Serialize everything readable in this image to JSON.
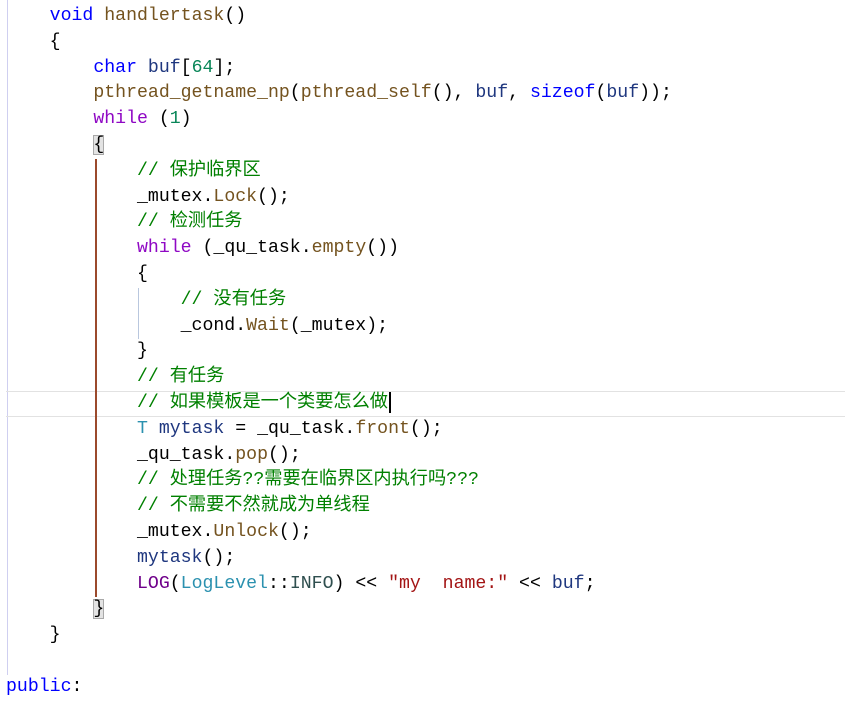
{
  "theme": {
    "background": "#ffffff",
    "text": "#000000",
    "margin_line": "#cfcff0",
    "current_line_border": "#e2e2e2",
    "brace_match_fill": "#e3e3e3",
    "brace_match_border": "#a9a9a9",
    "caret": "#000000",
    "syntax": {
      "keyword": "#0000ff",
      "control-keyword": "#8f08c4",
      "function": "#74531f",
      "local-variable": "#1f377f",
      "member-field": "#000000",
      "type": "#2b91af",
      "macro": "#6f008a",
      "enum-member": "#2f4f4f",
      "number": "#098658",
      "string": "#a31515",
      "comment": "#008000"
    }
  },
  "editor": {
    "lines": [
      {
        "tokens": [
          {
            "t": "    "
          },
          {
            "t": "void",
            "c": "#0000ff"
          },
          {
            "t": " "
          },
          {
            "t": "handlertask",
            "c": "#74531f"
          },
          {
            "t": "()"
          }
        ]
      },
      {
        "tokens": [
          {
            "t": "    "
          },
          {
            "t": "{"
          }
        ]
      },
      {
        "tokens": [
          {
            "t": "        "
          },
          {
            "t": "char",
            "c": "#0000ff"
          },
          {
            "t": " "
          },
          {
            "t": "buf",
            "c": "#1f377f"
          },
          {
            "t": "["
          },
          {
            "t": "64",
            "c": "#098658"
          },
          {
            "t": "];"
          }
        ]
      },
      {
        "tokens": [
          {
            "t": "        "
          },
          {
            "t": "pthread_getname_np",
            "c": "#74531f"
          },
          {
            "t": "("
          },
          {
            "t": "pthread_self",
            "c": "#74531f"
          },
          {
            "t": "(), "
          },
          {
            "t": "buf",
            "c": "#1f377f"
          },
          {
            "t": ", "
          },
          {
            "t": "sizeof",
            "c": "#0000ff"
          },
          {
            "t": "("
          },
          {
            "t": "buf",
            "c": "#1f377f"
          },
          {
            "t": "));"
          }
        ]
      },
      {
        "tokens": [
          {
            "t": "        "
          },
          {
            "t": "while",
            "c": "#8f08c4"
          },
          {
            "t": " ("
          },
          {
            "t": "1",
            "c": "#098658"
          },
          {
            "t": ")"
          }
        ]
      },
      {
        "tokens": [
          {
            "t": "        "
          },
          {
            "t": "{",
            "match": true
          }
        ],
        "guide": "#9b4a2c"
      },
      {
        "tokens": [
          {
            "t": "            "
          },
          {
            "t": "// 保护临界区",
            "c": "#008000"
          }
        ]
      },
      {
        "tokens": [
          {
            "t": "            "
          },
          {
            "t": "_mutex",
            "c": "#000000"
          },
          {
            "t": "."
          },
          {
            "t": "Lock",
            "c": "#74531f"
          },
          {
            "t": "();"
          }
        ]
      },
      {
        "tokens": [
          {
            "t": "            "
          },
          {
            "t": "// 检测任务",
            "c": "#008000"
          }
        ]
      },
      {
        "tokens": [
          {
            "t": "            "
          },
          {
            "t": "while",
            "c": "#8f08c4"
          },
          {
            "t": " ("
          },
          {
            "t": "_qu_task",
            "c": "#000000"
          },
          {
            "t": "."
          },
          {
            "t": "empty",
            "c": "#74531f"
          },
          {
            "t": "())"
          }
        ]
      },
      {
        "tokens": [
          {
            "t": "            "
          },
          {
            "t": "{"
          }
        ],
        "guide": "#b9c7de"
      },
      {
        "tokens": [
          {
            "t": "                "
          },
          {
            "t": "// 没有任务",
            "c": "#008000"
          }
        ]
      },
      {
        "tokens": [
          {
            "t": "                "
          },
          {
            "t": "_cond",
            "c": "#000000"
          },
          {
            "t": "."
          },
          {
            "t": "Wait",
            "c": "#74531f"
          },
          {
            "t": "("
          },
          {
            "t": "_mutex",
            "c": "#000000"
          },
          {
            "t": ");"
          }
        ]
      },
      {
        "tokens": [
          {
            "t": "            "
          },
          {
            "t": "}"
          }
        ]
      },
      {
        "tokens": [
          {
            "t": "            "
          },
          {
            "t": "// 有任务",
            "c": "#008000"
          }
        ]
      },
      {
        "tokens": [
          {
            "t": "            "
          },
          {
            "t": "// 如果模板是一个类要怎么做",
            "c": "#008000"
          }
        ],
        "current": true,
        "cursor": true
      },
      {
        "tokens": [
          {
            "t": "            "
          },
          {
            "t": "T",
            "c": "#2b91af"
          },
          {
            "t": " "
          },
          {
            "t": "mytask",
            "c": "#1f377f"
          },
          {
            "t": " = "
          },
          {
            "t": "_qu_task",
            "c": "#000000"
          },
          {
            "t": "."
          },
          {
            "t": "front",
            "c": "#74531f"
          },
          {
            "t": "();"
          }
        ]
      },
      {
        "tokens": [
          {
            "t": "            "
          },
          {
            "t": "_qu_task",
            "c": "#000000"
          },
          {
            "t": "."
          },
          {
            "t": "pop",
            "c": "#74531f"
          },
          {
            "t": "();"
          }
        ]
      },
      {
        "tokens": [
          {
            "t": "            "
          },
          {
            "t": "// 处理任务??需要在临界区内执行吗???",
            "c": "#008000"
          }
        ]
      },
      {
        "tokens": [
          {
            "t": "            "
          },
          {
            "t": "// 不需要不然就成为单线程",
            "c": "#008000"
          }
        ]
      },
      {
        "tokens": [
          {
            "t": "            "
          },
          {
            "t": "_mutex",
            "c": "#000000"
          },
          {
            "t": "."
          },
          {
            "t": "Unlock",
            "c": "#74531f"
          },
          {
            "t": "();"
          }
        ]
      },
      {
        "tokens": [
          {
            "t": "            "
          },
          {
            "t": "mytask",
            "c": "#1f377f"
          },
          {
            "t": "();"
          }
        ]
      },
      {
        "tokens": [
          {
            "t": "            "
          },
          {
            "t": "LOG",
            "c": "#6f008a"
          },
          {
            "t": "("
          },
          {
            "t": "LogLevel",
            "c": "#2b91af"
          },
          {
            "t": "::"
          },
          {
            "t": "INFO",
            "c": "#2f4f4f"
          },
          {
            "t": ") << "
          },
          {
            "t": "\"my  name:\"",
            "c": "#a31515"
          },
          {
            "t": " << "
          },
          {
            "t": "buf",
            "c": "#1f377f"
          },
          {
            "t": ";"
          }
        ]
      },
      {
        "tokens": [
          {
            "t": "        "
          },
          {
            "t": "}",
            "match": true
          }
        ]
      },
      {
        "tokens": [
          {
            "t": "    "
          },
          {
            "t": "}"
          }
        ]
      },
      {
        "tokens": []
      },
      {
        "tokens": [
          {
            "t": "public",
            "c": "#0000ff"
          },
          {
            "t": ":"
          }
        ]
      }
    ]
  }
}
